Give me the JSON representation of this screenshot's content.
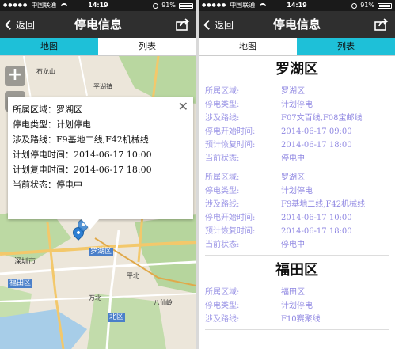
{
  "status_bar": {
    "carrier": "中国联通",
    "time": "14:19",
    "battery": "91%"
  },
  "left_screen": {
    "nav": {
      "back_label": "返回",
      "title": "停电信息"
    },
    "tabs": [
      {
        "label": "地图",
        "active": true
      },
      {
        "label": "列表",
        "active": false
      }
    ],
    "map": {
      "zoom_in": "+",
      "zoom_out": "−",
      "labels": {
        "shitoutang": "石龙山",
        "pingshan": "平湖镇",
        "shenzhen": "深圳市",
        "luohu": "罗湖区",
        "futian": "福田区",
        "pingbei": "平北",
        "wanbei": "万北",
        "beiqu": "北区",
        "basiuling": "八仙岭"
      },
      "popup": {
        "close": "✕",
        "rows": [
          {
            "label": "所属区域：",
            "value": "罗湖区"
          },
          {
            "label": "停电类型：",
            "value": "计划停电"
          },
          {
            "label": "涉及路线：",
            "value": "F9基地二线,F42机械线"
          },
          {
            "label": "计划停电时间：",
            "value": "2014-06-17 10:00"
          },
          {
            "label": "计划复电时间：",
            "value": "2014-06-17 18:00"
          },
          {
            "label": "当前状态：",
            "value": "停电中"
          }
        ]
      }
    }
  },
  "right_screen": {
    "nav": {
      "back_label": "返回",
      "title": "停电信息"
    },
    "tabs": [
      {
        "label": "地图",
        "active": false
      },
      {
        "label": "列表",
        "active": true
      }
    ],
    "list": [
      {
        "district": "罗湖区",
        "records": [
          [
            {
              "label": "所属区域:",
              "value": "罗湖区"
            },
            {
              "label": "停电类型:",
              "value": "计划停电"
            },
            {
              "label": "涉及路线:",
              "value": "F07文百线,F08宝邮线"
            },
            {
              "label": "停电开始时间:",
              "value": "2014-06-17 09:00"
            },
            {
              "label": "预计恢复时间:",
              "value": "2014-06-17 18:00"
            },
            {
              "label": "当前状态:",
              "value": "停电中"
            }
          ],
          [
            {
              "label": "所属区域:",
              "value": "罗湖区"
            },
            {
              "label": "停电类型:",
              "value": "计划停电"
            },
            {
              "label": "涉及路线:",
              "value": "F9基地二线,F42机械线"
            },
            {
              "label": "停电开始时间:",
              "value": "2014-06-17 10:00"
            },
            {
              "label": "预计恢复时间:",
              "value": "2014-06-17 18:00"
            },
            {
              "label": "当前状态:",
              "value": "停电中"
            }
          ]
        ]
      },
      {
        "district": "福田区",
        "records": [
          [
            {
              "label": "所属区域:",
              "value": "福田区"
            },
            {
              "label": "停电类型:",
              "value": "计划停电"
            },
            {
              "label": "涉及路线:",
              "value": "F10赛聚线"
            }
          ]
        ]
      }
    ]
  },
  "colors": {
    "navbar": "#2f2f2f",
    "tab_active": "#1ec0d8",
    "list_text": "#9b95e6"
  }
}
